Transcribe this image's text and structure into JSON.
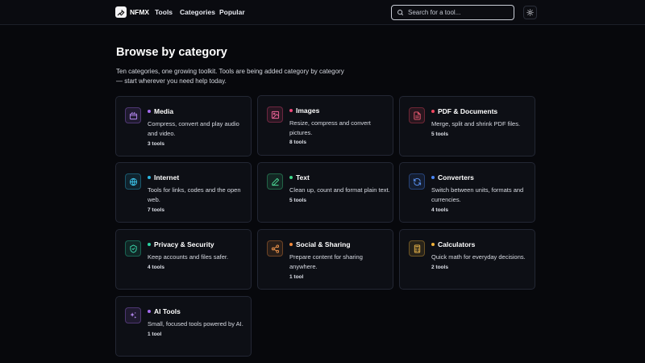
{
  "header": {
    "logo_text": "NFMX",
    "nav": [
      "Tools",
      "Categories",
      "Popular"
    ],
    "search_placeholder": "Search for a tool...",
    "theme_toggle_icon": "sun-icon"
  },
  "main": {
    "title": "Browse by category",
    "description": "Ten categories, one growing toolkit. Tools are being added category by category — start wherever you need help today."
  },
  "categories": [
    {
      "title": "Media",
      "description": "Compress, convert and play audio and video.",
      "count": "3 tools",
      "icon": "clapperboard-icon",
      "color": "#a56cf0"
    },
    {
      "title": "Images",
      "description": "Resize, compress and convert pictures.",
      "count": "8 tools",
      "icon": "image-icon",
      "color": "#f0477a"
    },
    {
      "title": "PDF & Documents",
      "description": "Merge, split and shrink PDF files.",
      "count": "5 tools",
      "icon": "file-text-icon",
      "color": "#f04760"
    },
    {
      "title": "Internet",
      "description": "Tools for links, codes and the open web.",
      "count": "7 tools",
      "icon": "globe-icon",
      "color": "#2bb7e0"
    },
    {
      "title": "Text",
      "description": "Clean up, count and format plain text.",
      "count": "5 tools",
      "icon": "pencil-icon",
      "color": "#3ed98a"
    },
    {
      "title": "Converters",
      "description": "Switch between units, formats and currencies.",
      "count": "4 tools",
      "icon": "refresh-icon",
      "color": "#4a86f5"
    },
    {
      "title": "Privacy & Security",
      "description": "Keep accounts and files safer.",
      "count": "4 tools",
      "icon": "shield-check-icon",
      "color": "#2bd3a3"
    },
    {
      "title": "Social & Sharing",
      "description": "Prepare content for sharing anywhere.",
      "count": "1 tool",
      "icon": "share-icon",
      "color": "#f28a3c"
    },
    {
      "title": "Calculators",
      "description": "Quick math for everyday decisions.",
      "count": "2 tools",
      "icon": "calculator-icon",
      "color": "#f0b23a"
    },
    {
      "title": "AI Tools",
      "description": "Small, focused tools powered by AI.",
      "count": "1 tool",
      "icon": "sparkles-icon",
      "color": "#a56cf0"
    }
  ]
}
